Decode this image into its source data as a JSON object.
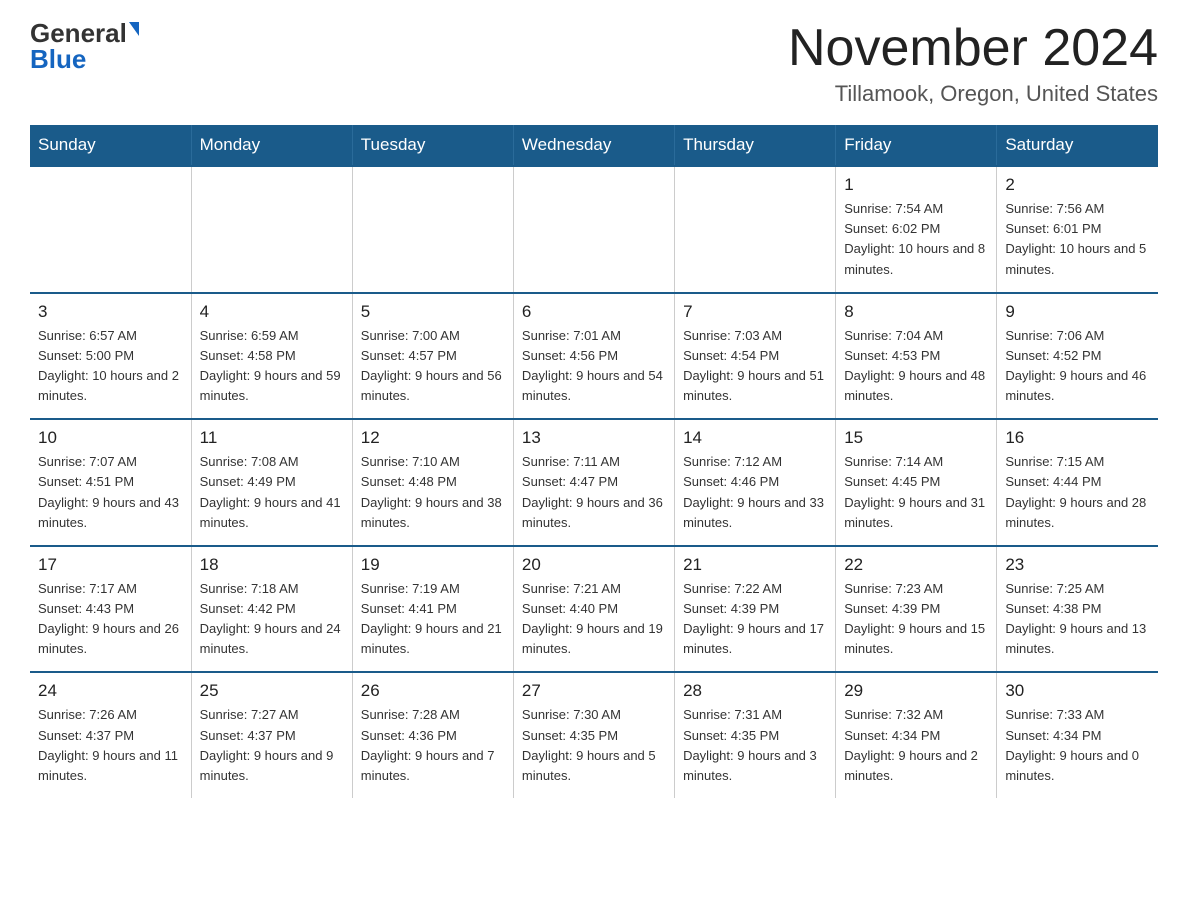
{
  "logo": {
    "general": "General",
    "blue": "Blue"
  },
  "title": "November 2024",
  "subtitle": "Tillamook, Oregon, United States",
  "weekdays": [
    "Sunday",
    "Monday",
    "Tuesday",
    "Wednesday",
    "Thursday",
    "Friday",
    "Saturday"
  ],
  "weeks": [
    [
      {
        "day": "",
        "info": ""
      },
      {
        "day": "",
        "info": ""
      },
      {
        "day": "",
        "info": ""
      },
      {
        "day": "",
        "info": ""
      },
      {
        "day": "",
        "info": ""
      },
      {
        "day": "1",
        "info": "Sunrise: 7:54 AM\nSunset: 6:02 PM\nDaylight: 10 hours and 8 minutes."
      },
      {
        "day": "2",
        "info": "Sunrise: 7:56 AM\nSunset: 6:01 PM\nDaylight: 10 hours and 5 minutes."
      }
    ],
    [
      {
        "day": "3",
        "info": "Sunrise: 6:57 AM\nSunset: 5:00 PM\nDaylight: 10 hours and 2 minutes."
      },
      {
        "day": "4",
        "info": "Sunrise: 6:59 AM\nSunset: 4:58 PM\nDaylight: 9 hours and 59 minutes."
      },
      {
        "day": "5",
        "info": "Sunrise: 7:00 AM\nSunset: 4:57 PM\nDaylight: 9 hours and 56 minutes."
      },
      {
        "day": "6",
        "info": "Sunrise: 7:01 AM\nSunset: 4:56 PM\nDaylight: 9 hours and 54 minutes."
      },
      {
        "day": "7",
        "info": "Sunrise: 7:03 AM\nSunset: 4:54 PM\nDaylight: 9 hours and 51 minutes."
      },
      {
        "day": "8",
        "info": "Sunrise: 7:04 AM\nSunset: 4:53 PM\nDaylight: 9 hours and 48 minutes."
      },
      {
        "day": "9",
        "info": "Sunrise: 7:06 AM\nSunset: 4:52 PM\nDaylight: 9 hours and 46 minutes."
      }
    ],
    [
      {
        "day": "10",
        "info": "Sunrise: 7:07 AM\nSunset: 4:51 PM\nDaylight: 9 hours and 43 minutes."
      },
      {
        "day": "11",
        "info": "Sunrise: 7:08 AM\nSunset: 4:49 PM\nDaylight: 9 hours and 41 minutes."
      },
      {
        "day": "12",
        "info": "Sunrise: 7:10 AM\nSunset: 4:48 PM\nDaylight: 9 hours and 38 minutes."
      },
      {
        "day": "13",
        "info": "Sunrise: 7:11 AM\nSunset: 4:47 PM\nDaylight: 9 hours and 36 minutes."
      },
      {
        "day": "14",
        "info": "Sunrise: 7:12 AM\nSunset: 4:46 PM\nDaylight: 9 hours and 33 minutes."
      },
      {
        "day": "15",
        "info": "Sunrise: 7:14 AM\nSunset: 4:45 PM\nDaylight: 9 hours and 31 minutes."
      },
      {
        "day": "16",
        "info": "Sunrise: 7:15 AM\nSunset: 4:44 PM\nDaylight: 9 hours and 28 minutes."
      }
    ],
    [
      {
        "day": "17",
        "info": "Sunrise: 7:17 AM\nSunset: 4:43 PM\nDaylight: 9 hours and 26 minutes."
      },
      {
        "day": "18",
        "info": "Sunrise: 7:18 AM\nSunset: 4:42 PM\nDaylight: 9 hours and 24 minutes."
      },
      {
        "day": "19",
        "info": "Sunrise: 7:19 AM\nSunset: 4:41 PM\nDaylight: 9 hours and 21 minutes."
      },
      {
        "day": "20",
        "info": "Sunrise: 7:21 AM\nSunset: 4:40 PM\nDaylight: 9 hours and 19 minutes."
      },
      {
        "day": "21",
        "info": "Sunrise: 7:22 AM\nSunset: 4:39 PM\nDaylight: 9 hours and 17 minutes."
      },
      {
        "day": "22",
        "info": "Sunrise: 7:23 AM\nSunset: 4:39 PM\nDaylight: 9 hours and 15 minutes."
      },
      {
        "day": "23",
        "info": "Sunrise: 7:25 AM\nSunset: 4:38 PM\nDaylight: 9 hours and 13 minutes."
      }
    ],
    [
      {
        "day": "24",
        "info": "Sunrise: 7:26 AM\nSunset: 4:37 PM\nDaylight: 9 hours and 11 minutes."
      },
      {
        "day": "25",
        "info": "Sunrise: 7:27 AM\nSunset: 4:37 PM\nDaylight: 9 hours and 9 minutes."
      },
      {
        "day": "26",
        "info": "Sunrise: 7:28 AM\nSunset: 4:36 PM\nDaylight: 9 hours and 7 minutes."
      },
      {
        "day": "27",
        "info": "Sunrise: 7:30 AM\nSunset: 4:35 PM\nDaylight: 9 hours and 5 minutes."
      },
      {
        "day": "28",
        "info": "Sunrise: 7:31 AM\nSunset: 4:35 PM\nDaylight: 9 hours and 3 minutes."
      },
      {
        "day": "29",
        "info": "Sunrise: 7:32 AM\nSunset: 4:34 PM\nDaylight: 9 hours and 2 minutes."
      },
      {
        "day": "30",
        "info": "Sunrise: 7:33 AM\nSunset: 4:34 PM\nDaylight: 9 hours and 0 minutes."
      }
    ]
  ]
}
